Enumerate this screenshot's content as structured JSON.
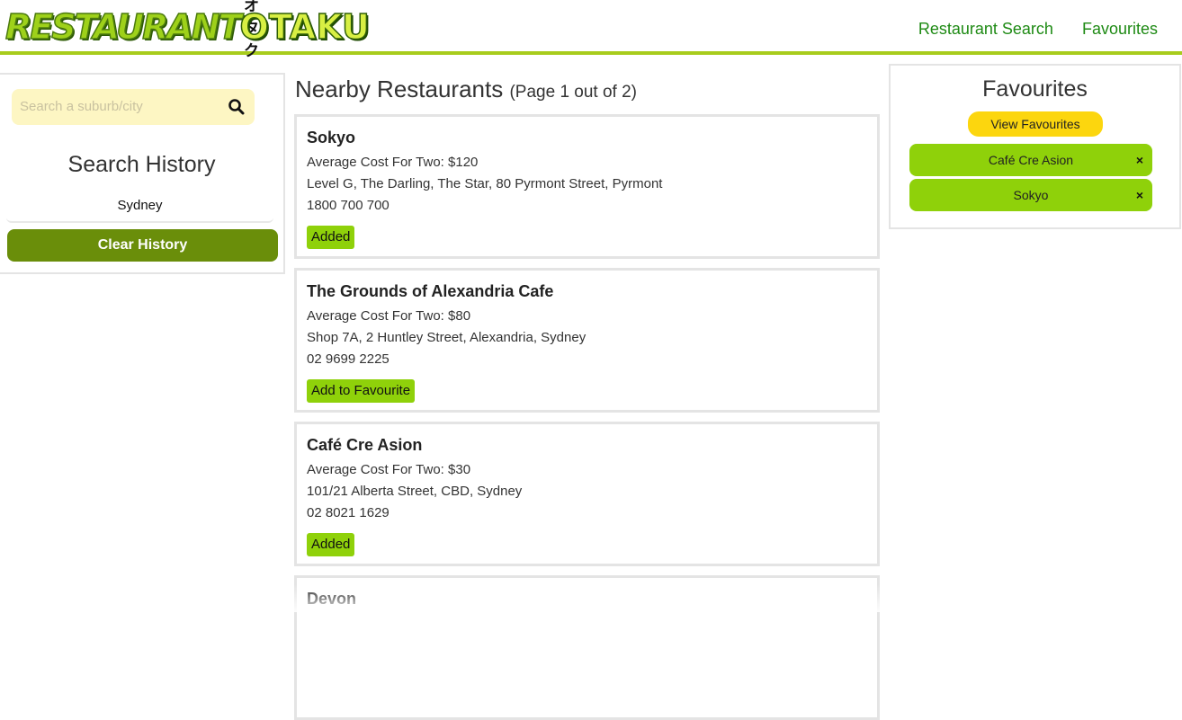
{
  "header": {
    "logo_main_a": "RESTAURANT",
    "logo_main_b": "OTAKU",
    "logo_kana": "オタク",
    "nav": [
      "Restaurant Search",
      "Favourites"
    ]
  },
  "sidebar": {
    "search_placeholder": "Search a suburb/city",
    "history_title": "Search History",
    "history_items": [
      "Sydney"
    ],
    "clear_label": "Clear History"
  },
  "main": {
    "title": "Nearby Restaurants",
    "page_info": "(Page 1 out of 2)",
    "restaurants": [
      {
        "name": "Sokyo",
        "cost": "Average Cost For Two: $120",
        "address": "Level G, The Darling, The Star, 80 Pyrmont Street, Pyrmont",
        "phone": "1800 700 700",
        "button": "Added"
      },
      {
        "name": "The Grounds of Alexandria Cafe",
        "cost": "Average Cost For Two: $80",
        "address": "Shop 7A, 2 Huntley Street, Alexandria, Sydney",
        "phone": "02 9699 2225",
        "button": "Add to Favourite"
      },
      {
        "name": "Café Cre Asion",
        "cost": "Average Cost For Two: $30",
        "address": "101/21 Alberta Street, CBD, Sydney",
        "phone": "02 8021 1629",
        "button": "Added"
      },
      {
        "name": "Devon",
        "cost": "",
        "address": "",
        "phone": "",
        "button": ""
      }
    ]
  },
  "favourites": {
    "title": "Favourites",
    "view_label": "View Favourites",
    "items": [
      "Café Cre Asion",
      "Sokyo"
    ],
    "remove_glyph": "×"
  },
  "colors": {
    "accent_green": "#8fd10a",
    "dark_green": "#6a8e0a",
    "nav_green": "#1e8a14",
    "search_bg": "#fdf6c3",
    "yellow_button": "#fcd60e"
  },
  "icons": [
    "search-icon",
    "close-icon"
  ]
}
